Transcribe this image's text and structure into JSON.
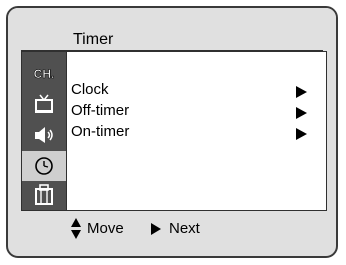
{
  "menu": {
    "title": "Timer",
    "items": [
      {
        "label": "Clock"
      },
      {
        "label": "Off-timer"
      },
      {
        "label": "On-timer"
      }
    ]
  },
  "sidebar": {
    "items": [
      {
        "icon": "channel-icon",
        "label": "CH."
      },
      {
        "icon": "tv-picture-icon"
      },
      {
        "icon": "speaker-sound-icon"
      },
      {
        "icon": "clock-timer-icon",
        "active": true
      },
      {
        "icon": "setup-case-icon"
      }
    ]
  },
  "footer": {
    "move_label": "Move",
    "next_label": "Next"
  }
}
